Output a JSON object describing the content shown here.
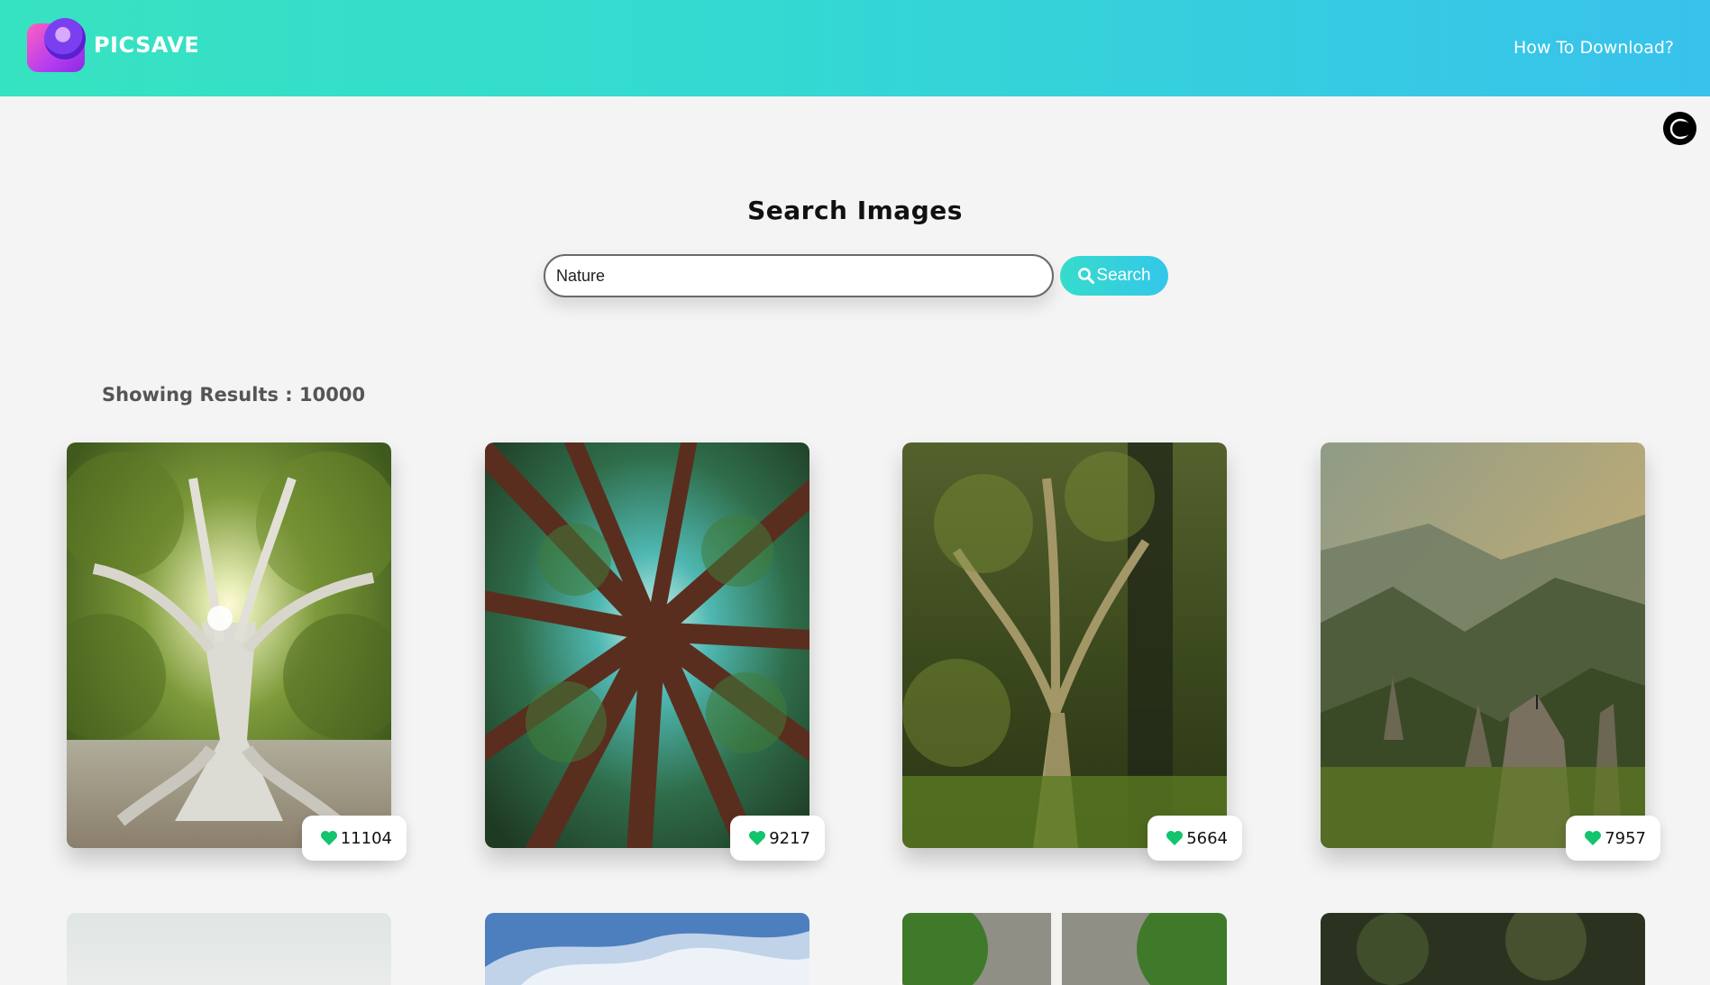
{
  "header": {
    "brand": "PICSAVE",
    "nav_link": "How To Download?"
  },
  "theme_toggle_icon": "crescent-moon-icon",
  "search": {
    "title": "Search Images",
    "value": "Nature",
    "button_label": "Search",
    "button_icon": "magnifier-icon"
  },
  "results": {
    "label": "Showing Results : 10000"
  },
  "cards": [
    {
      "likes": "11104",
      "image": "banyan tree with sun"
    },
    {
      "likes": "9217",
      "image": "redwood canopy looking up"
    },
    {
      "likes": "5664",
      "image": "mossy forest tree"
    },
    {
      "likes": "7957",
      "image": "misty mountain valley"
    }
  ],
  "colors": {
    "header_start": "#36e3c0",
    "header_end": "#38c2ec",
    "like_heart": "#12c46b",
    "background": "#f4f4f4"
  }
}
